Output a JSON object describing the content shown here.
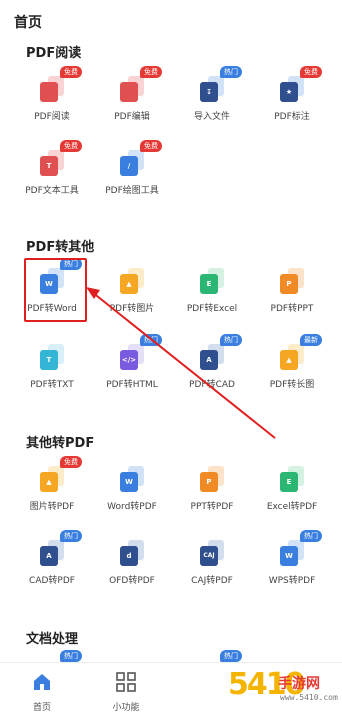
{
  "page_title": "首页",
  "colors": {
    "red": "#e53935",
    "blue": "#3a7fe0",
    "green": "#2bb673",
    "orange": "#f5a623",
    "navy": "#2f4f8f",
    "purple": "#7a5be0",
    "cyan": "#35b5d6"
  },
  "sections": {
    "pdf_read": {
      "title": "PDF阅读",
      "tools": [
        {
          "label": "PDF阅读",
          "badge": "免费",
          "icon": "pdf-reader-icon"
        },
        {
          "label": "PDF编辑",
          "badge": "免费",
          "icon": "pdf-edit-icon"
        },
        {
          "label": "导入文件",
          "badge": "热门",
          "icon": "import-file-icon"
        },
        {
          "label": "PDF标注",
          "badge": "免费",
          "icon": "pdf-annotate-icon"
        },
        {
          "label": "PDF文本工具",
          "badge": "免费",
          "icon": "pdf-text-tool-icon"
        },
        {
          "label": "PDF绘图工具",
          "badge": "免费",
          "icon": "pdf-draw-tool-icon"
        }
      ]
    },
    "pdf_to_other": {
      "title": "PDF转其他",
      "tools": [
        {
          "label": "PDF转Word",
          "badge": "热门",
          "icon": "word-icon",
          "glyph": "W"
        },
        {
          "label": "PDF转图片",
          "badge": "",
          "icon": "image-icon",
          "glyph": ""
        },
        {
          "label": "PDF转Excel",
          "badge": "",
          "icon": "excel-icon",
          "glyph": "E"
        },
        {
          "label": "PDF转PPT",
          "badge": "",
          "icon": "ppt-icon",
          "glyph": "P"
        },
        {
          "label": "PDF转TXT",
          "badge": "",
          "icon": "txt-icon",
          "glyph": "T"
        },
        {
          "label": "PDF转HTML",
          "badge": "热门",
          "icon": "html-icon",
          "glyph": "</>"
        },
        {
          "label": "PDF转CAD",
          "badge": "热门",
          "icon": "cad-icon",
          "glyph": "A"
        },
        {
          "label": "PDF转长图",
          "badge": "最新",
          "icon": "long-image-icon",
          "glyph": ""
        }
      ]
    },
    "other_to_pdf": {
      "title": "其他转PDF",
      "tools": [
        {
          "label": "图片转PDF",
          "badge": "免费",
          "icon": "image-to-pdf-icon",
          "glyph": ""
        },
        {
          "label": "Word转PDF",
          "badge": "",
          "icon": "word-to-pdf-icon",
          "glyph": "W"
        },
        {
          "label": "PPT转PDF",
          "badge": "",
          "icon": "ppt-to-pdf-icon",
          "glyph": "P"
        },
        {
          "label": "Excel转PDF",
          "badge": "",
          "icon": "excel-to-pdf-icon",
          "glyph": "E"
        },
        {
          "label": "CAD转PDF",
          "badge": "热门",
          "icon": "cad-to-pdf-icon",
          "glyph": "A"
        },
        {
          "label": "OFD转PDF",
          "badge": "",
          "icon": "ofd-to-pdf-icon",
          "glyph": "d"
        },
        {
          "label": "CAJ转PDF",
          "badge": "",
          "icon": "caj-to-pdf-icon",
          "glyph": "CAJ"
        },
        {
          "label": "WPS转PDF",
          "badge": "热门",
          "icon": "wps-to-pdf-icon",
          "glyph": "W"
        }
      ]
    },
    "doc_process": {
      "title": "文档处理",
      "tools": [
        {
          "label": "",
          "badge": "热门"
        },
        {
          "label": "",
          "badge": ""
        },
        {
          "label": "",
          "badge": "热门"
        },
        {
          "label": "",
          "badge": ""
        }
      ]
    }
  },
  "tabbar": {
    "home": {
      "label": "首页",
      "icon": "home-icon"
    },
    "tools": {
      "label": "小功能",
      "icon": "grid-icon"
    }
  },
  "watermark": {
    "digits": "5410",
    "site": "手游网",
    "url": "www.5410.com"
  }
}
